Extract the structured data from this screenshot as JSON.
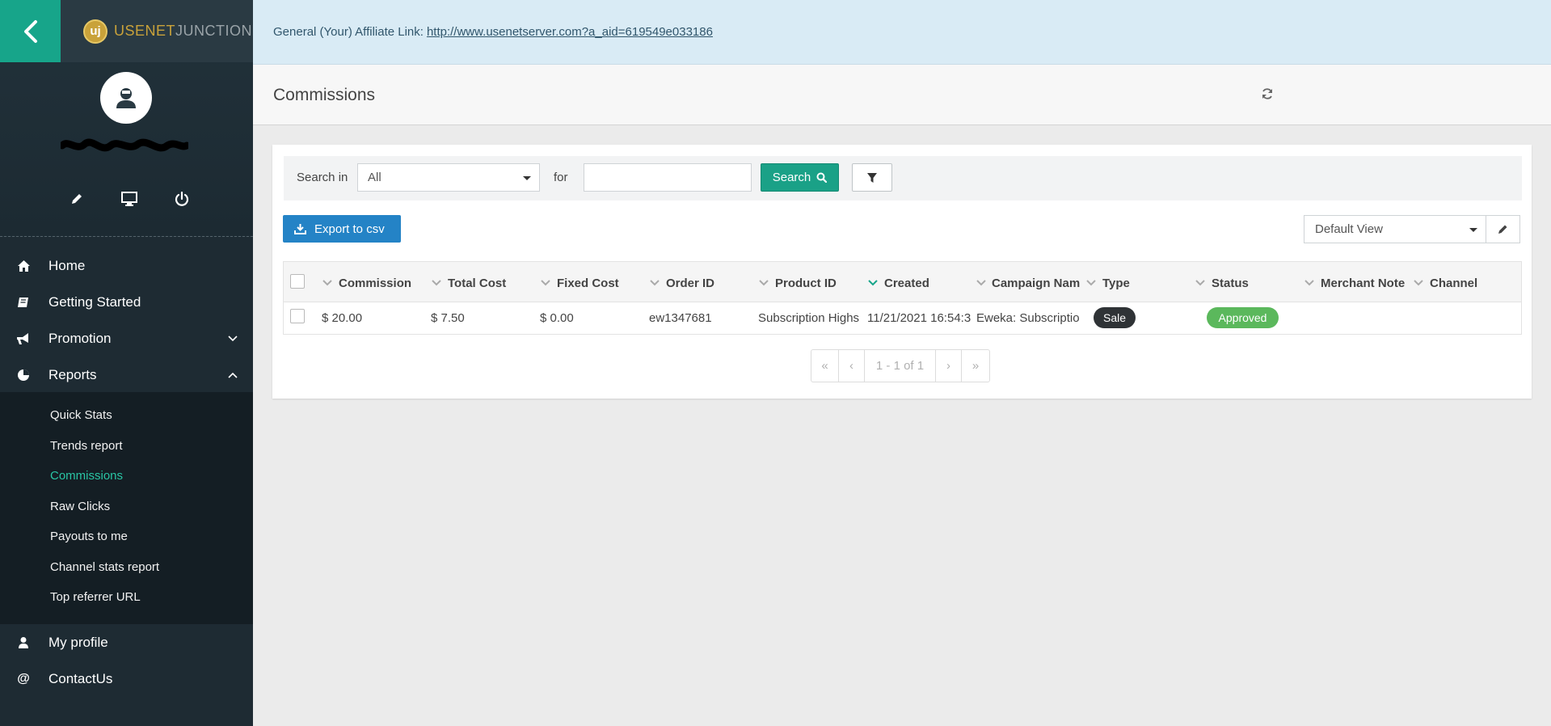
{
  "header": {
    "brand_initials": "uj",
    "brand_name_bold": "USENET",
    "brand_name_light": "JUNCTION"
  },
  "banner": {
    "label": "General (Your) Affiliate Link:",
    "link": "http://www.usenetserver.com?a_aid=619549e033186"
  },
  "sidebar": {
    "nav": [
      {
        "label": "Home",
        "icon": "home-icon"
      },
      {
        "label": "Getting Started",
        "icon": "book-icon"
      },
      {
        "label": "Promotion",
        "icon": "bullhorn-icon",
        "expanded": false
      },
      {
        "label": "Reports",
        "icon": "pie-chart-icon",
        "expanded": true
      }
    ],
    "submenu": [
      {
        "label": "Quick Stats"
      },
      {
        "label": "Trends report"
      },
      {
        "label": "Commissions",
        "active": true
      },
      {
        "label": "Raw Clicks"
      },
      {
        "label": "Payouts to me"
      },
      {
        "label": "Channel stats report"
      },
      {
        "label": "Top referrer URL"
      }
    ],
    "bottom_nav": [
      {
        "label": "My profile",
        "icon": "user-icon"
      },
      {
        "label": "ContactUs",
        "icon": "at-icon"
      }
    ]
  },
  "page": {
    "title": "Commissions"
  },
  "search": {
    "search_in_label": "Search in",
    "selected": "All",
    "for_label": "for",
    "query": "",
    "button_label": "Search"
  },
  "toolbar": {
    "export_label": "Export to csv",
    "view_selected": "Default View"
  },
  "table": {
    "columns": [
      "Commission",
      "Total Cost",
      "Fixed Cost",
      "Order ID",
      "Product ID",
      "Created",
      "Campaign Nam",
      "Type",
      "Status",
      "Merchant Note",
      "Channel"
    ],
    "sorted_column": "Created",
    "rows": [
      {
        "commission": "$ 20.00",
        "total_cost": "$ 7.50",
        "fixed_cost": "$ 0.00",
        "order_id": "ew1347681",
        "product_id": "Subscription Highs",
        "created": "11/21/2021 16:54:3",
        "campaign": "Eweka: Subscriptio",
        "type": "Sale",
        "status": "Approved",
        "merchant_note": "",
        "channel": ""
      }
    ]
  },
  "pagination": {
    "first": "«",
    "prev": "‹",
    "info": "1 - 1 of 1",
    "next": "›",
    "last": "»"
  },
  "colors": {
    "accent": "#17a58a",
    "sidebar_bg": "#1e2b33",
    "primary_button": "#2483c6",
    "approved": "#5bb85c",
    "active_link": "#29c5a4"
  }
}
